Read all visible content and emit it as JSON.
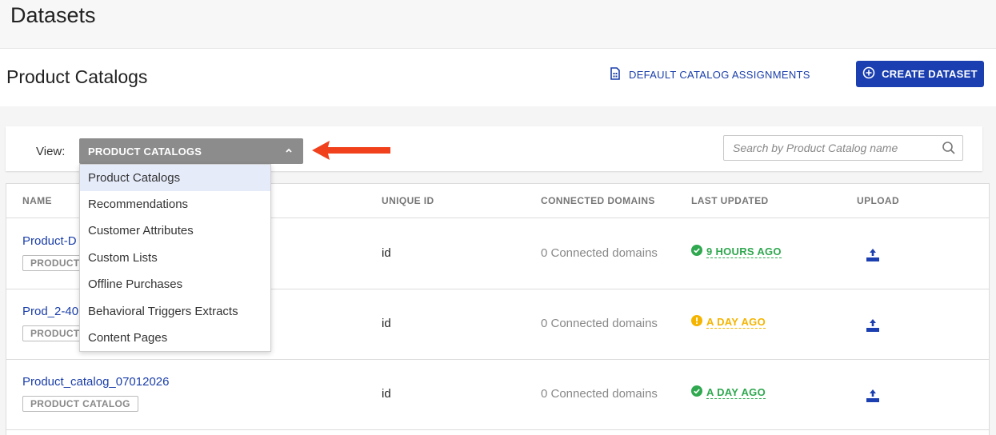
{
  "page": {
    "title": "Datasets"
  },
  "section": {
    "title": "Product Catalogs",
    "default_link_label": "DEFAULT CATALOG ASSIGNMENTS",
    "create_button_label": "CREATE DATASET"
  },
  "view": {
    "label": "View:",
    "selected": "PRODUCT CATALOGS",
    "options": [
      "Product Catalogs",
      "Recommendations",
      "Customer Attributes",
      "Custom Lists",
      "Offline Purchases",
      "Behavioral Triggers Extracts",
      "Content Pages"
    ]
  },
  "search": {
    "placeholder": "Search by Product Catalog name",
    "value": ""
  },
  "table": {
    "columns": [
      "NAME",
      "UNIQUE ID",
      "CONNECTED DOMAINS",
      "LAST UPDATED",
      "UPLOAD"
    ],
    "rows": [
      {
        "name": "Product-D",
        "tag": "PRODUCT",
        "unique_id": "id",
        "domains": "0 Connected domains",
        "updated": "9 HOURS AGO",
        "status": "success"
      },
      {
        "name": "Prod_2-40",
        "tag": "PRODUCT",
        "unique_id": "id",
        "domains": "0 Connected domains",
        "updated": "A DAY AGO",
        "status": "warning"
      },
      {
        "name": "Product_catalog_07012026",
        "tag": "PRODUCT CATALOG",
        "unique_id": "id",
        "domains": "0 Connected domains",
        "updated": "A DAY AGO",
        "status": "success"
      }
    ]
  },
  "colors": {
    "accent": "#1b3fb0",
    "link": "#1a3eaa",
    "success": "#2fa84f",
    "warning": "#f4b400",
    "annotation_arrow": "#f0401c",
    "select_bg": "#8c8c8c"
  }
}
